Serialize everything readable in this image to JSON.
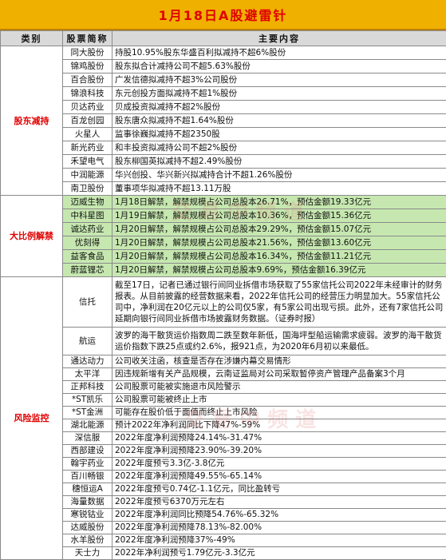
{
  "title": "1月18日A股避雷针",
  "headers": {
    "category": "类别",
    "stock": "股票简称",
    "content": "主要内容"
  },
  "watermark": "交 易 中 频 道",
  "sections": {
    "reduce": {
      "label": "股东减持",
      "rows": [
        {
          "name": "同大股份",
          "text": "持股10.95%股东华盛百利拟减持不超6%股份"
        },
        {
          "name": "锦鸡股份",
          "text": "股东拟合计减持公司不超5.63%股份"
        },
        {
          "name": "百合股份",
          "text": "广发信德拟减持不超3%公司股份"
        },
        {
          "name": "锦浪科技",
          "text": "东元创投方面拟减持不超1%股份"
        },
        {
          "name": "贝达药业",
          "text": "贝成投资拟减持不超2%股份"
        },
        {
          "name": "百龙创园",
          "text": "股东唐众拟减持不超1.64%股份"
        },
        {
          "name": "火星人",
          "text": "监事徐巍拟减持不超2350股"
        },
        {
          "name": "新光药业",
          "text": "和丰投资拟减持公司不超2%股份"
        },
        {
          "name": "禾望电气",
          "text": "股东柳国英拟减持不超2.49%股份"
        },
        {
          "name": "中润能源",
          "text": "华兴创投、华兴新兴拟减持合计不超1.26%股份"
        },
        {
          "name": "南卫股份",
          "text": "董事项华拟减持不超13.11万股"
        }
      ]
    },
    "unlock": {
      "label": "大比例解禁",
      "rows": [
        {
          "name": "迈威生物",
          "text": "1月18日解禁，解禁规模占公司总股本26.71%，预估金额19.33亿元"
        },
        {
          "name": "中科星图",
          "text": "1月19日解禁，解禁规模占公司总股本10.36%，预估金额15.36亿元"
        },
        {
          "name": "诚达药业",
          "text": "1月20日解禁，解禁规模占公司总股本29.29%，预估金额15.07亿元"
        },
        {
          "name": "优刻得",
          "text": "1月20日解禁，解禁规模占公司总股本21.56%，预估金额13.60亿元"
        },
        {
          "name": "益客食品",
          "text": "1月20日解禁，解禁规模占公司总股本16.34%，预估金额11.21亿元"
        },
        {
          "name": "蔚蓝锂芯",
          "text": "1月20日解禁，解禁规模占公司总股本9.69%，预估金额16.39亿元"
        }
      ]
    },
    "risk": {
      "label": "风险监控",
      "rows": [
        {
          "name": "信托",
          "text": "截至17日，记者已通过银行间同业拆借市场获取了55家信托公司2022年未经审计的财务报表。从目前披露的经营数据来看，2022年信托公司的经营压力明显加大。55家信托公司中，净利润在20亿元以上的公司仅5家，有5家公司出现亏损。此外，还有7家信托公司延期向银行间同业拆借市场披露财务数据。（证券时报）"
        },
        {
          "name": "航运",
          "text": "波罗的海干散货运价指数周二跌至数年新低，国海坪型船运输需求疲弱。波罗的海干散货运价指数下跌25点或约2.6%，报921点，为2020年6月初以来最低。"
        },
        {
          "name": "通达动力",
          "text": "公司收关注函，核查是否存在涉嫌内幕交易情形"
        },
        {
          "name": "太平洋",
          "text": "因违规新增有关产品规模，云南证监局对公司采取暂停资产管理产品备案3个月"
        },
        {
          "name": "正邦科技",
          "text": "公司股票可能被实施退市风险警示"
        },
        {
          "name": "*ST凯乐",
          "text": "公司股票可能被终止上市"
        },
        {
          "name": "*ST金洲",
          "text": "可能存在股价低于面值而终止上市风险"
        },
        {
          "name": "湖北能源",
          "text": "预计2022年净利润同比下降47%-59%"
        },
        {
          "name": "深信服",
          "text": "2022年度净利润预降24.14%-31.47%"
        },
        {
          "name": "西部建设",
          "text": "2022年度净利润预降23.90%-39.20%"
        },
        {
          "name": "翰宇药业",
          "text": "2022年度预亏3.3亿-3.8亿元"
        },
        {
          "name": "百川畅银",
          "text": "2022年度净利润预降49.55%-65.14%"
        },
        {
          "name": "穗恒运A",
          "text": "2022年度预亏0.74亿-1.1亿元，同比盈转亏"
        },
        {
          "name": "海量数据",
          "text": "2022年度预亏6370万元左右"
        },
        {
          "name": "寒锐钴业",
          "text": "2022年度净利润同比预降54.76%-65.32%"
        },
        {
          "name": "达威股份",
          "text": "2022年度净利润预降78.13%-82.00%"
        },
        {
          "name": "水羊股份",
          "text": "2022年度净利润预降37%-49%"
        },
        {
          "name": "天士力",
          "text": "2022年净利润预亏1.79亿元-3.3亿元"
        }
      ]
    }
  }
}
